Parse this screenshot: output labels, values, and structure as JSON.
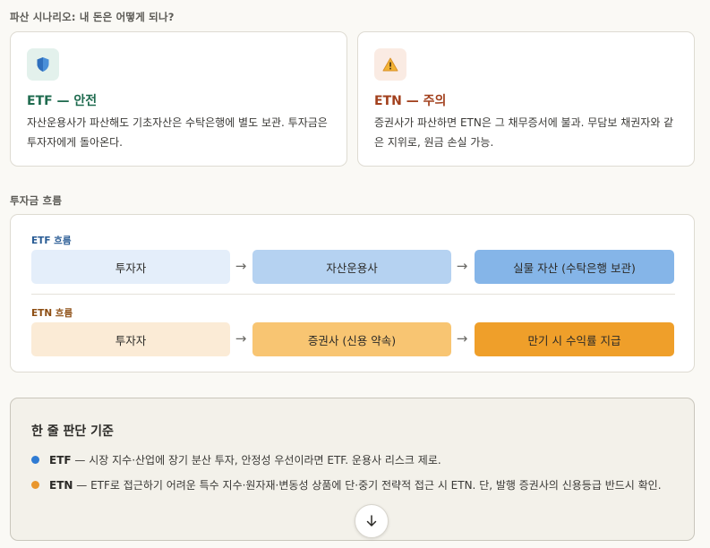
{
  "scenario": {
    "label": "파산 시나리오: 내 돈은 어떻게 되나?"
  },
  "cards": {
    "etf": {
      "icon": "shield-icon",
      "title": "ETF — 안전",
      "text": "자산운용사가 파산해도 기초자산은 수탁은행에 별도 보관. 투자금은 투자자에게 돌아온다.",
      "color": "#1f6b4f",
      "icon_bg": "#e3f1ec"
    },
    "etn": {
      "icon": "warning-icon",
      "title": "ETN — 주의",
      "text": "증권사가 파산하면 ETN은 그 채무증서에 불과. 무담보 채권자와 같은 지위로, 원금 손실 가능.",
      "color": "#a2401d",
      "icon_bg": "#faebe3"
    }
  },
  "flow": {
    "label": "투자금 흐름",
    "etf": {
      "tag": "ETF 흐름",
      "color": "#285b94",
      "steps": [
        "투자자",
        "자산운용사",
        "실물 자산 (수탁은행 보관)"
      ],
      "step_colors": [
        "#e4eefa",
        "#b5d2f1",
        "#85b5e8"
      ]
    },
    "etn": {
      "tag": "ETN 흐름",
      "color": "#8d4d12",
      "steps": [
        "투자자",
        "증권사 (신용 약속)",
        "만기 시 수익률 지급"
      ],
      "step_colors": [
        "#fbebd6",
        "#f8c572",
        "#ef9f2a"
      ]
    },
    "arrow": "→"
  },
  "criteria": {
    "title": "한 줄 판단 기준",
    "items": [
      {
        "term": "ETF",
        "text": " — 시장 지수·산업에 장기 분산 투자, 안정성 우선이라면 ETF. 운용사 리스크 제로.",
        "color": "#2f7bd3"
      },
      {
        "term": "ETN",
        "text": " — ETF로 접근하기 어려운 특수 지수·원자재·변동성 상품에 단·중기 전략적 접근 시 ETN. 단, 발행 증권사의 신용등급 반드시 확인.",
        "color": "#e9962c"
      }
    ]
  },
  "scroll_button": {
    "icon": "arrow-down-icon"
  }
}
